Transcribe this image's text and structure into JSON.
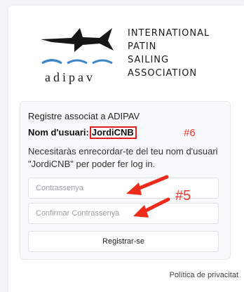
{
  "logo": {
    "brand": "adipav",
    "org_lines": [
      "INTERNATIONAL",
      "PATIN",
      "SAILING",
      "ASSOCIATION"
    ]
  },
  "form": {
    "heading": "Registre associat a ADIPAV",
    "username_label": "Nom d'usuari:",
    "username_value": "JordiCNB",
    "info": "Necesitaràs enrecordar-te del teu nom d'usuari \"JordiCNB\" per poder fer log in.",
    "password_placeholder": "Contrassenya",
    "confirm_placeholder": "Confirmar Contrassenya",
    "submit_label": "Registrar-se"
  },
  "annotations": {
    "tag_username": "#6",
    "tag_passwords": "#5",
    "color": "#ee3a2a"
  },
  "footer": {
    "privacy_link": "Política de privacitat"
  },
  "colors": {
    "page_bg": "#f3f4f6",
    "panel_bg": "#f8f9fb",
    "logo_wave": "#3f86c6"
  }
}
